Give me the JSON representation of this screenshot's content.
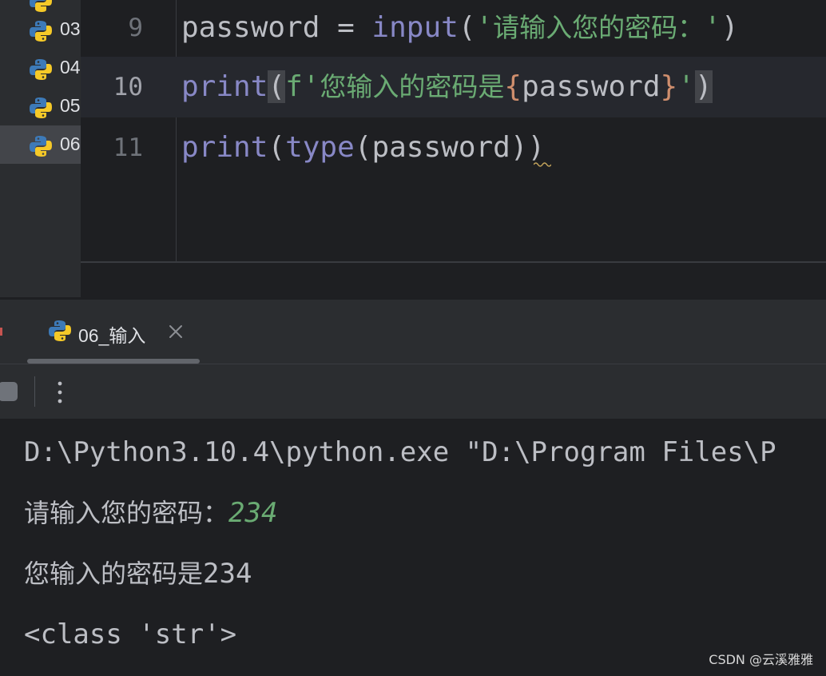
{
  "sidebar": {
    "items": [
      {
        "label": "03",
        "selected": false
      },
      {
        "label": "04",
        "selected": false
      },
      {
        "label": "05",
        "selected": false
      },
      {
        "label": "06",
        "selected": true
      }
    ],
    "icon": "python-file-icon"
  },
  "editor": {
    "current_line": "10",
    "lines": [
      {
        "number": "9",
        "tokens": {
          "var": "password",
          "op": " = ",
          "fn": "input",
          "open": "(",
          "q1": "'",
          "str": "请输入您的密码：",
          "q2": "'",
          "close": ")"
        }
      },
      {
        "number": "10",
        "tokens": {
          "fn": "print",
          "open": "(",
          "prefix": "f'",
          "str": "您输入的密码是",
          "brace_open": "{",
          "var": "password",
          "brace_close": "}",
          "q2": "'",
          "close": ")"
        }
      },
      {
        "number": "11",
        "tokens": {
          "fn": "print",
          "open": "(",
          "fn2": "type",
          "open2": "(",
          "var": "password",
          "close2": ")",
          "close": ")"
        }
      }
    ]
  },
  "run_window": {
    "tab": {
      "label": "06_输入",
      "icon": "python-file-icon",
      "close_icon": "close-icon"
    },
    "toolbar": {
      "stop_icon": "stop-icon",
      "more_icon": "more-vertical-icon"
    },
    "console": {
      "command": "D:\\Python3.10.4\\python.exe \"D:\\Program Files\\P",
      "prompt": "请输入您的密码：",
      "user_input": "234",
      "output1_text": "您输入的密码是",
      "output1_value": "234",
      "output2": "<class 'str'>"
    }
  },
  "watermark": "CSDN @云溪雅雅",
  "colors": {
    "background": "#1e1f22",
    "panel": "#2b2d30",
    "function": "#8888c6",
    "string": "#6aab73",
    "brace": "#cf8e6d",
    "text": "#bcbec4"
  }
}
